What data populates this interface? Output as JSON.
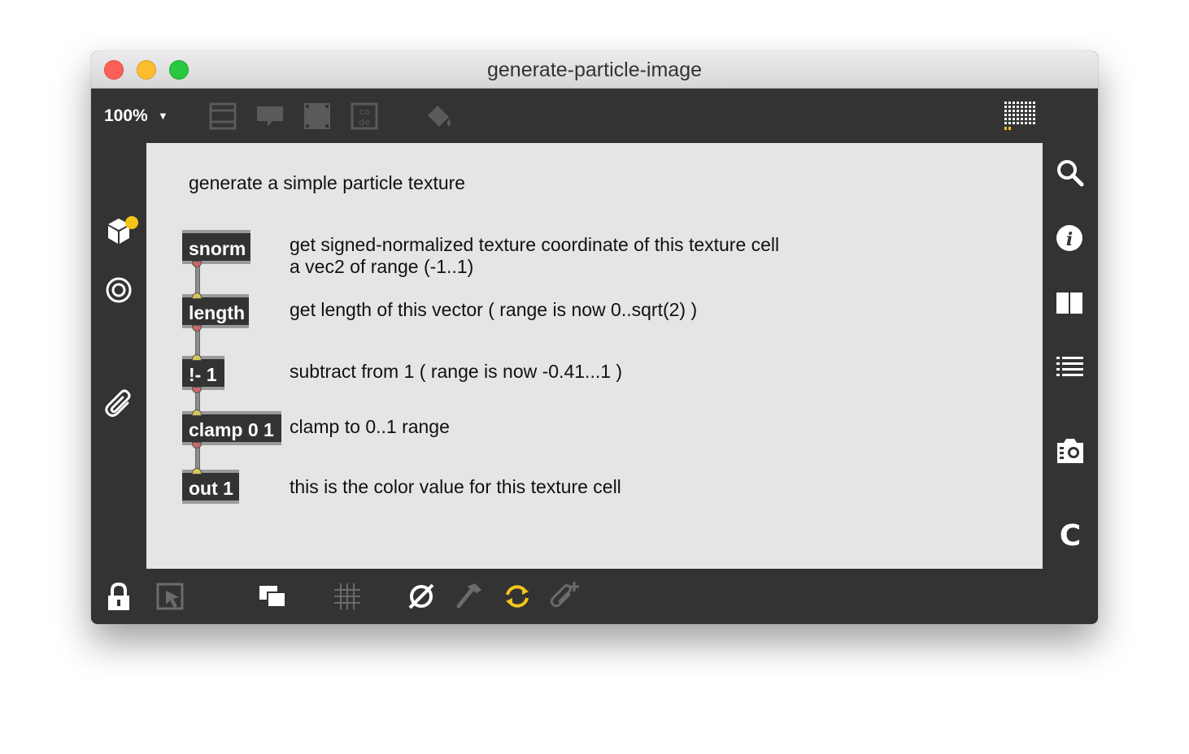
{
  "window": {
    "title": "generate-particle-image"
  },
  "toolbar": {
    "zoom": "100%",
    "zoom_arrow": "▼"
  },
  "patch": {
    "header_comment": "generate a simple particle texture",
    "objects": [
      {
        "label": "snorm"
      },
      {
        "label": "length"
      },
      {
        "label": "!- 1"
      },
      {
        "label": "clamp 0 1"
      },
      {
        "label": "out 1"
      }
    ],
    "comments": [
      {
        "line1": "get signed-normalized texture coordinate of this texture cell",
        "line2": "a vec2 of range (-1..1)"
      },
      {
        "line1": "get length of this vector ( range is now 0..sqrt(2) )"
      },
      {
        "line1": "subtract from 1 ( range is now -0.41...1 )"
      },
      {
        "line1": "clamp to 0..1 range"
      },
      {
        "line1": "this is the color value for this texture cell"
      }
    ]
  },
  "icons": {
    "top": [
      "presentation-icon",
      "comment-icon",
      "object-box-icon",
      "code-icon",
      "paint-bucket-icon",
      "grid-palette-icon"
    ],
    "left": [
      "package-icon",
      "target-icon",
      "paperclip-icon"
    ],
    "right": [
      "search-icon",
      "info-icon",
      "columns-icon",
      "list-icon",
      "snapshot-icon",
      "c-icon"
    ],
    "bottom": [
      "lock-icon",
      "presentation-mode-icon",
      "windows-icon",
      "grid-icon",
      "no-icon",
      "hammer-icon",
      "refresh-icon",
      "add-clip-icon"
    ]
  },
  "colors": {
    "accent": "#f5c518",
    "panel": "#333333",
    "canvas": "#e5e5e5"
  }
}
